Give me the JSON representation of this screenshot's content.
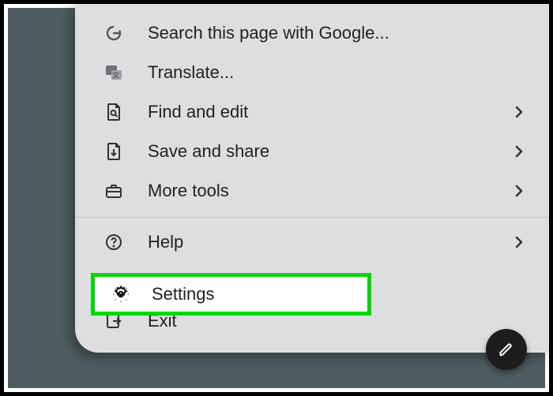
{
  "menu": {
    "section1": [
      {
        "icon": "google-icon",
        "label": "Search this page with Google...",
        "hasSubmenu": false
      },
      {
        "icon": "translate-icon",
        "label": "Translate...",
        "hasSubmenu": false
      },
      {
        "icon": "find-icon",
        "label": "Find and edit",
        "hasSubmenu": true
      },
      {
        "icon": "save-share-icon",
        "label": "Save and share",
        "hasSubmenu": true
      },
      {
        "icon": "toolbox-icon",
        "label": "More tools",
        "hasSubmenu": true
      }
    ],
    "section2": [
      {
        "icon": "help-icon",
        "label": "Help",
        "hasSubmenu": true
      },
      {
        "icon": "gear-icon",
        "label": "Settings",
        "hasSubmenu": false,
        "highlighted": true
      },
      {
        "icon": "exit-icon",
        "label": "Exit",
        "hasSubmenu": false
      }
    ]
  },
  "highlight_color": "#00d600",
  "fab_icon": "edit-icon"
}
